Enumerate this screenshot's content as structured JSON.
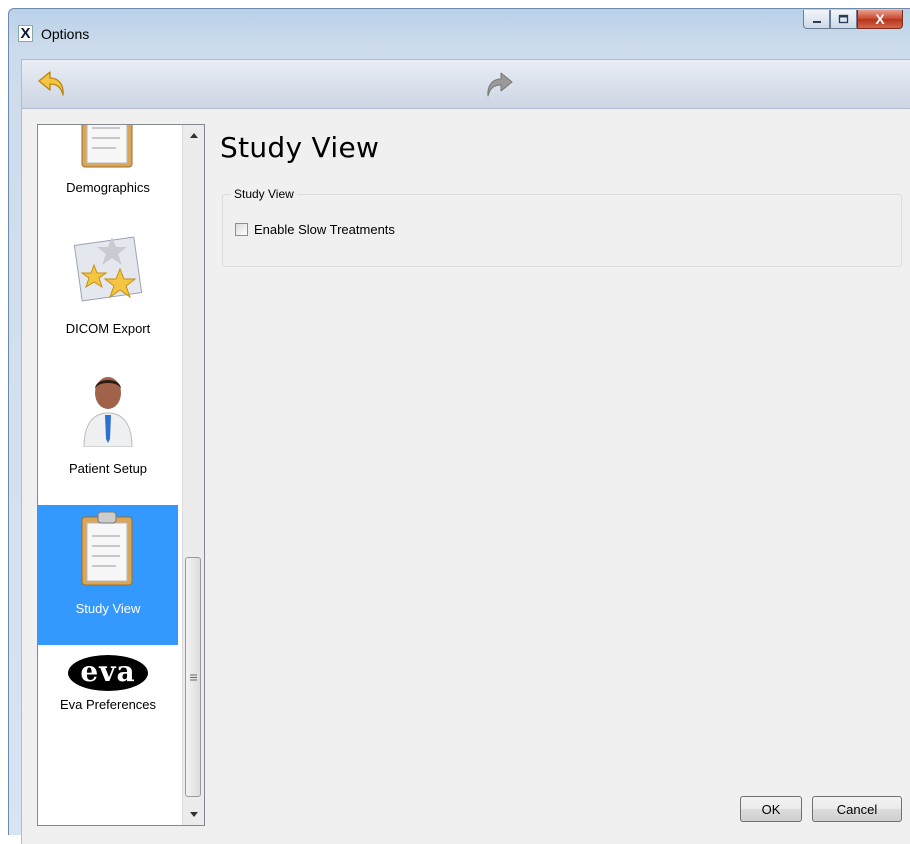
{
  "window": {
    "title": "Options",
    "app_icon_glyph": "X"
  },
  "caption_buttons": {
    "close_glyph": "X"
  },
  "nav": {
    "back_icon": "back-arrow-icon",
    "forward_icon": "forward-arrow-icon"
  },
  "sidebar": {
    "items": [
      {
        "label": "Demographics",
        "icon": "clipboard-icon",
        "selected": false
      },
      {
        "label": "DICOM Export",
        "icon": "stars-envelope-icon",
        "selected": false
      },
      {
        "label": "Patient Setup",
        "icon": "person-icon",
        "selected": false
      },
      {
        "label": "Study View",
        "icon": "clipboard-icon",
        "selected": true
      },
      {
        "label": "Eva Preferences",
        "icon": "eva-logo-icon",
        "selected": false
      }
    ],
    "selected_color": "#3399ff"
  },
  "page": {
    "title": "Study View"
  },
  "group": {
    "legend": "Study View",
    "options": [
      {
        "label": "Enable Slow Treatments",
        "checked": false
      }
    ]
  },
  "eva_logo_text": "eva",
  "buttons": {
    "ok": "OK",
    "cancel": "Cancel"
  }
}
